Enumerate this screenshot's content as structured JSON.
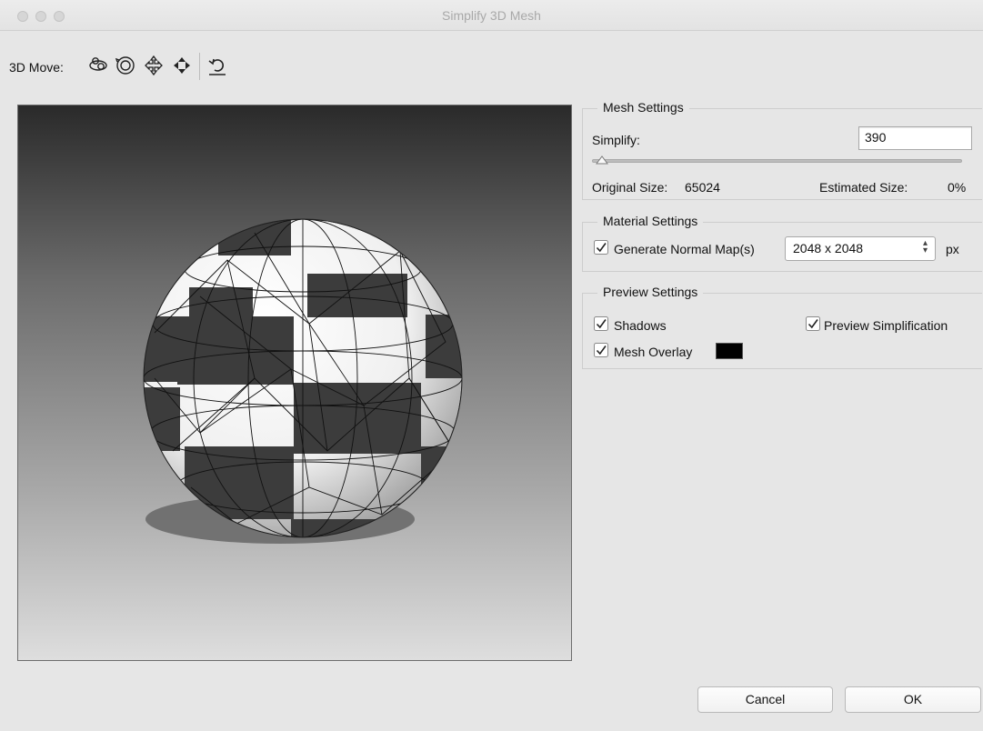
{
  "window": {
    "title": "Simplify 3D Mesh"
  },
  "toolbar": {
    "label": "3D Move:",
    "tools": [
      "orbit-icon",
      "roll-icon",
      "pan-icon",
      "slide-icon",
      "reset-view-icon"
    ]
  },
  "mesh_settings": {
    "title": "Mesh Settings",
    "simplify_label": "Simplify:",
    "simplify_value": "390",
    "slider_level": 0.01,
    "original_size_label": "Original Size:",
    "original_size_value": "65024",
    "estimated_size_label": "Estimated Size:",
    "estimated_size_value": "0%"
  },
  "material_settings": {
    "title": "Material Settings",
    "normal_map_label": "Generate Normal Map(s)",
    "normal_map_checked": true,
    "resolution_selected": "2048 x 2048",
    "unit": "px"
  },
  "preview_settings": {
    "title": "Preview Settings",
    "shadows_label": "Shadows",
    "shadows_checked": true,
    "preview_simplification_label": "Preview Simplification",
    "preview_simplification_checked": true,
    "mesh_overlay_label": "Mesh Overlay",
    "mesh_overlay_checked": true,
    "mesh_overlay_color": "#000000"
  },
  "buttons": {
    "cancel": "Cancel",
    "ok": "OK"
  }
}
